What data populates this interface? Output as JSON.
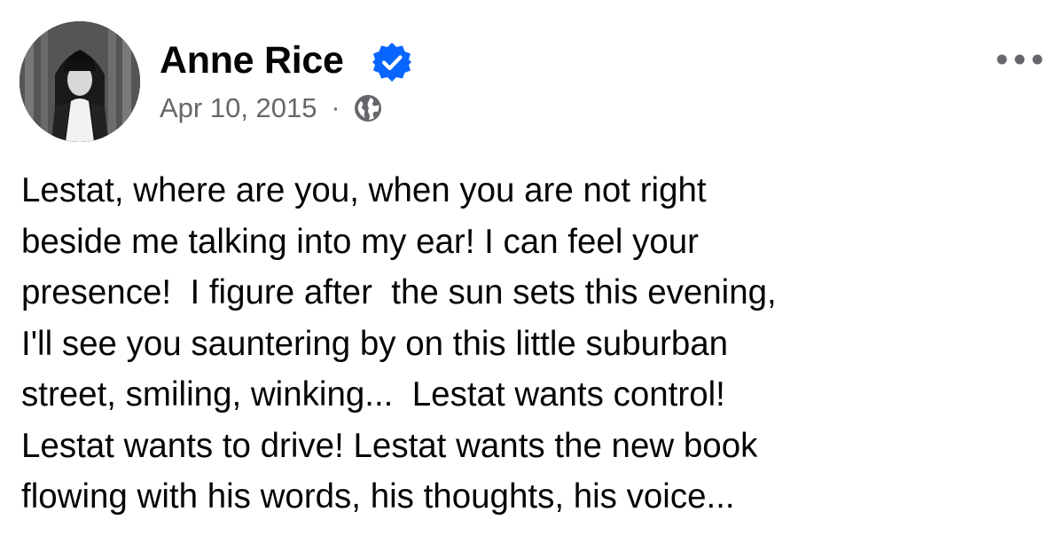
{
  "post": {
    "author": {
      "name": "Anne Rice",
      "verified": true,
      "avatar_icon": "profile-photo"
    },
    "meta": {
      "date": "Apr 10, 2015",
      "separator": "·",
      "audience_icon": "globe-icon"
    },
    "more_icon": "more-horizontal-icon",
    "text": "Lestat, where are you, when you are not right\nbeside me talking into my ear! I can feel your\npresence!  I figure after  the sun sets this evening,\nI'll see you sauntering by on this little suburban\nstreet, smiling, winking...  Lestat wants control!\nLestat wants to drive! Lestat wants the new book\nflowing with his words, his thoughts, his voice..."
  },
  "colors": {
    "text": "#050505",
    "secondary_text": "#65676b",
    "verified_blue": "#0866ff",
    "more_icon": "#65676b"
  }
}
